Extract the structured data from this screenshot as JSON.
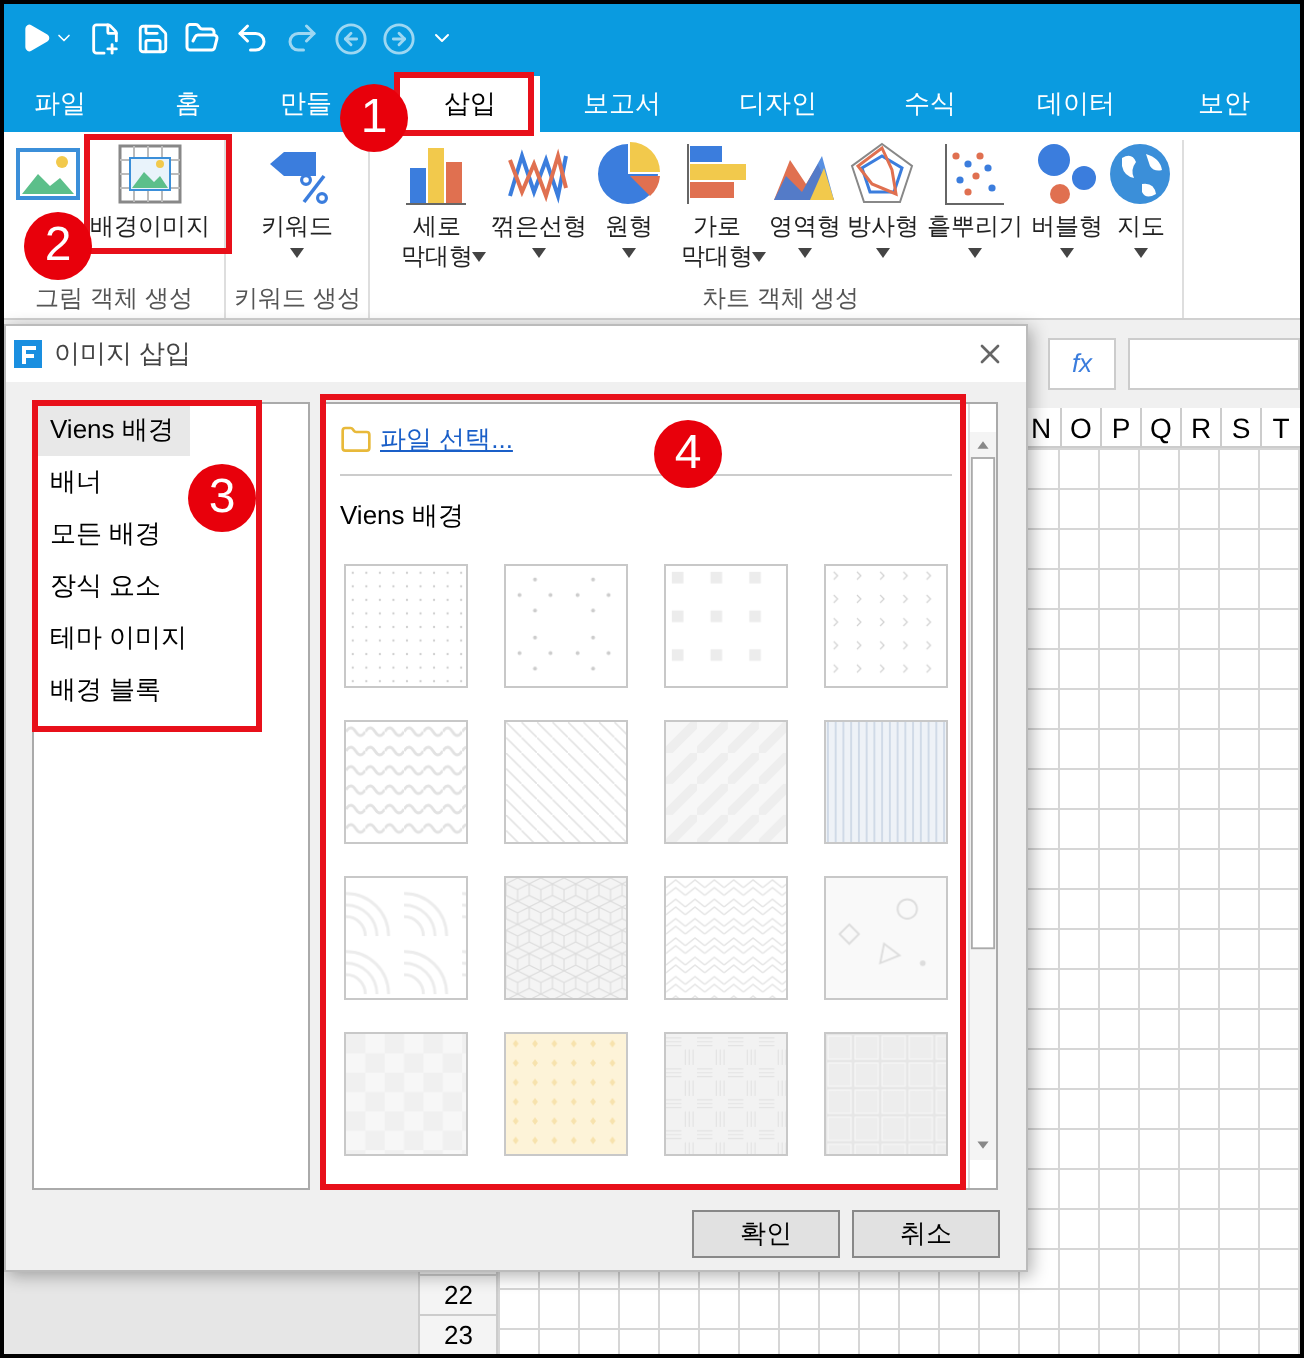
{
  "tabs": [
    {
      "label": "파일",
      "selected": false
    },
    {
      "label": "홈",
      "selected": false
    },
    {
      "label": "만들",
      "selected": false
    },
    {
      "label": "삽입",
      "selected": true
    },
    {
      "label": "보고서",
      "selected": false
    },
    {
      "label": "디자인",
      "selected": false
    },
    {
      "label": "수식",
      "selected": false
    },
    {
      "label": "데이터",
      "selected": false
    },
    {
      "label": "보안",
      "selected": false
    }
  ],
  "ribbon": [
    {
      "label": "그림 객체 생성",
      "items": [
        {
          "kind": "picture"
        },
        {
          "kind": "background",
          "lines": [
            "배경이미지"
          ],
          "dropdown": false
        }
      ]
    },
    {
      "label": "키워드 생성",
      "items": [
        {
          "kind": "keyword",
          "lines": [
            "키워드"
          ],
          "dropdown": true
        }
      ]
    },
    {
      "label": "차트 객체 생성",
      "items": [
        {
          "kind": "column",
          "lines": [
            "세로",
            "막대형"
          ],
          "dropdown": true
        },
        {
          "kind": "line",
          "lines": [
            "꺾은선형"
          ],
          "dropdown": true
        },
        {
          "kind": "pie",
          "lines": [
            "원형"
          ],
          "dropdown": true
        },
        {
          "kind": "bar",
          "lines": [
            "가로",
            "막대형"
          ],
          "dropdown": true
        },
        {
          "kind": "area",
          "lines": [
            "영역형"
          ],
          "dropdown": true
        },
        {
          "kind": "radar",
          "lines": [
            "방사형"
          ],
          "dropdown": true
        },
        {
          "kind": "scatter",
          "lines": [
            "흩뿌리기"
          ],
          "dropdown": true
        },
        {
          "kind": "bubble",
          "lines": [
            "버블형"
          ],
          "dropdown": true
        },
        {
          "kind": "map",
          "lines": [
            "지도"
          ],
          "dropdown": true
        }
      ]
    }
  ],
  "formula_bar": {
    "function_button": "fx"
  },
  "sheet": {
    "columns": [
      "N",
      "O",
      "P",
      "Q",
      "R",
      "S",
      "T"
    ],
    "rows": [
      "22",
      "23"
    ]
  },
  "dialog": {
    "title": "이미지 삽입",
    "categories": [
      {
        "label": "Viens 배경",
        "selected": true
      },
      {
        "label": "배너",
        "selected": false
      },
      {
        "label": "모든 배경",
        "selected": false
      },
      {
        "label": "장식 요소",
        "selected": false
      },
      {
        "label": "테마 이미지",
        "selected": false
      },
      {
        "label": "배경 블록",
        "selected": false
      }
    ],
    "file_link": "파일 선택...",
    "section_title": "Viens 배경",
    "thumbnails": [
      {
        "kind": "dots"
      },
      {
        "kind": "sparse-dots"
      },
      {
        "kind": "squares"
      },
      {
        "kind": "chevrons"
      },
      {
        "kind": "waves"
      },
      {
        "kind": "diagonal-lines"
      },
      {
        "kind": "wide-stripes"
      },
      {
        "kind": "vertical-texture"
      },
      {
        "kind": "arcs"
      },
      {
        "kind": "cubes"
      },
      {
        "kind": "zigzag"
      },
      {
        "kind": "shapes"
      },
      {
        "kind": "checker"
      },
      {
        "kind": "yellow-diamonds"
      },
      {
        "kind": "weave"
      },
      {
        "kind": "tiles"
      }
    ],
    "buttons": [
      "확인",
      "취소"
    ]
  },
  "annotations": [
    "1",
    "2",
    "3",
    "4"
  ]
}
